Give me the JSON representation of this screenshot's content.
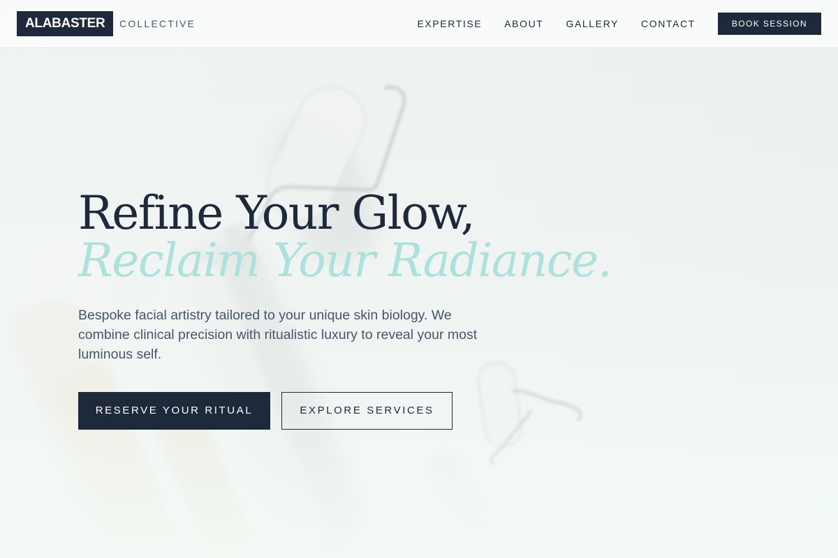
{
  "header": {
    "logo_text": "ALABASTER",
    "logo_sub": "COLLECTIVE",
    "nav": [
      {
        "label": "EXPERTISE"
      },
      {
        "label": "ABOUT"
      },
      {
        "label": "GALLERY"
      },
      {
        "label": "CONTACT"
      }
    ],
    "cta_label": "BOOK SESSION"
  },
  "hero": {
    "title_line1": "Refine Your Glow,",
    "title_line2": "Reclaim Your Radiance.",
    "body": "Bespoke facial artistry tailored to your unique skin biology. We combine clinical precision with ritualistic luxury to reveal your most luminous self.",
    "primary_button": "RESERVE YOUR RITUAL",
    "secondary_button": "EXPLORE SERVICES",
    "background_image": "blurred-facial-rollers"
  },
  "colors": {
    "navy": "#1e293b",
    "accent_mint": "#aee0dc",
    "body_text": "#475569",
    "background": "#eef3f1"
  }
}
